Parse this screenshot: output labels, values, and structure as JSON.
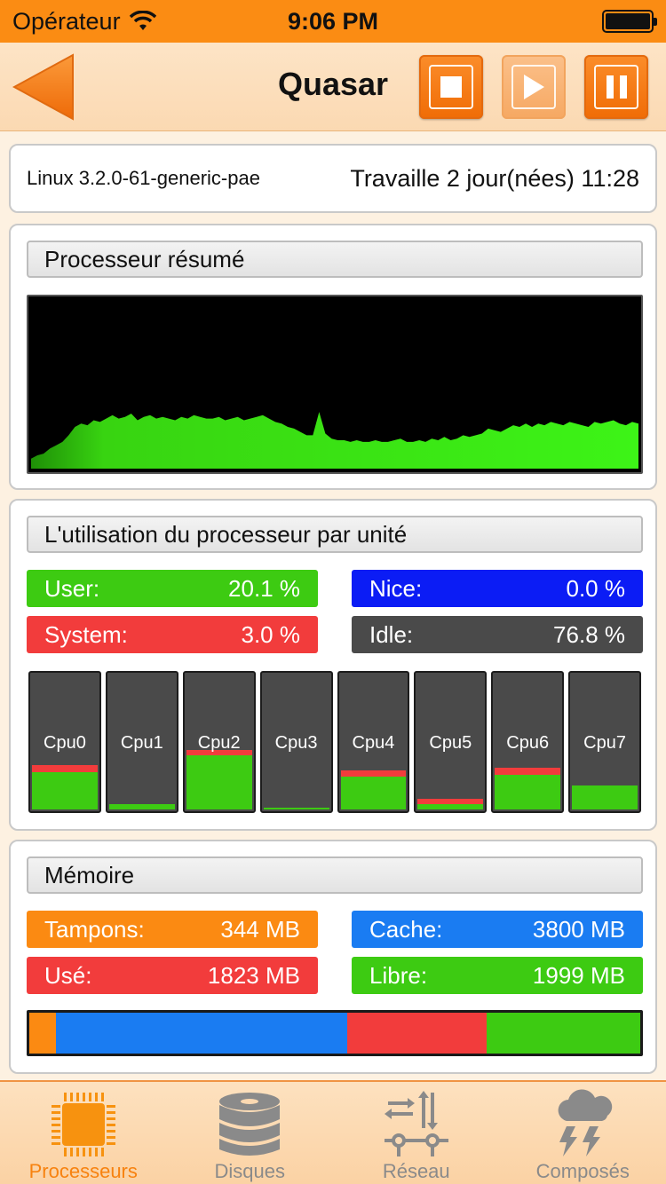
{
  "status_bar": {
    "carrier": "Opérateur",
    "time": "9:06 PM"
  },
  "nav": {
    "title": "Quasar"
  },
  "system": {
    "kernel": "Linux 3.2.0-61-generic-pae",
    "uptime": "Travaille 2 jour(nées) 11:28"
  },
  "processor_summary": {
    "header": "Processeur résumé",
    "load_history_percent": [
      6,
      8,
      9,
      12,
      14,
      16,
      20,
      25,
      27,
      26,
      29,
      28,
      30,
      32,
      30,
      31,
      33,
      29,
      31,
      32,
      30,
      31,
      30,
      29,
      31,
      30,
      32,
      31,
      30,
      30,
      31,
      29,
      30,
      31,
      29,
      30,
      31,
      32,
      30,
      28,
      27,
      25,
      24,
      22,
      20,
      20,
      34,
      21,
      18,
      17,
      17,
      16,
      17,
      16,
      16,
      17,
      16,
      16,
      17,
      18,
      16,
      16,
      17,
      16,
      18,
      17,
      19,
      17,
      18,
      20,
      19,
      20,
      21,
      24,
      23,
      22,
      24,
      26,
      25,
      27,
      25,
      27,
      26,
      28,
      27,
      26,
      28,
      27,
      26,
      25,
      28,
      27,
      28,
      29,
      27,
      26,
      28,
      27
    ]
  },
  "unit_usage": {
    "header": "L'utilisation du processeur par unité",
    "stats": {
      "user": {
        "label": "User:",
        "value": "20.1 %"
      },
      "nice": {
        "label": "Nice:",
        "value": "0.0 %"
      },
      "system": {
        "label": "System:",
        "value": "3.0 %"
      },
      "idle": {
        "label": "Idle:",
        "value": "76.8 %"
      }
    },
    "cpus": [
      {
        "name": "Cpu0",
        "user_pct": 27,
        "system_pct": 5
      },
      {
        "name": "Cpu1",
        "user_pct": 4,
        "system_pct": 0
      },
      {
        "name": "Cpu2",
        "user_pct": 39,
        "system_pct": 4
      },
      {
        "name": "Cpu3",
        "user_pct": 1,
        "system_pct": 0
      },
      {
        "name": "Cpu4",
        "user_pct": 24,
        "system_pct": 4
      },
      {
        "name": "Cpu5",
        "user_pct": 4,
        "system_pct": 4
      },
      {
        "name": "Cpu6",
        "user_pct": 25,
        "system_pct": 5
      },
      {
        "name": "Cpu7",
        "user_pct": 17,
        "system_pct": 0
      }
    ],
    "colors": {
      "user": "#3dcb12",
      "nice": "#0b1cf5",
      "system": "#f23c3c",
      "idle": "#4a4a4a"
    }
  },
  "memory": {
    "header": "Mémoire",
    "stats": {
      "buffers": {
        "label": "Tampons:",
        "value": "344 MB",
        "mb": 344
      },
      "cache": {
        "label": "Cache:",
        "value": "3800 MB",
        "mb": 3800
      },
      "used": {
        "label": "Usé:",
        "value": "1823 MB",
        "mb": 1823
      },
      "free": {
        "label": "Libre:",
        "value": "1999 MB",
        "mb": 1999
      }
    },
    "colors": {
      "buffers": "#fb8a12",
      "cache": "#1a7cf2",
      "used": "#f23c3c",
      "free": "#3dcb12"
    }
  },
  "tabs": [
    {
      "label": "Processeurs",
      "icon": "cpu-chip-icon",
      "active": true
    },
    {
      "label": "Disques",
      "icon": "disk-stack-icon",
      "active": false
    },
    {
      "label": "Réseau",
      "icon": "network-arrows-icon",
      "active": false
    },
    {
      "label": "Composés",
      "icon": "storm-cloud-icon",
      "active": false
    }
  ]
}
